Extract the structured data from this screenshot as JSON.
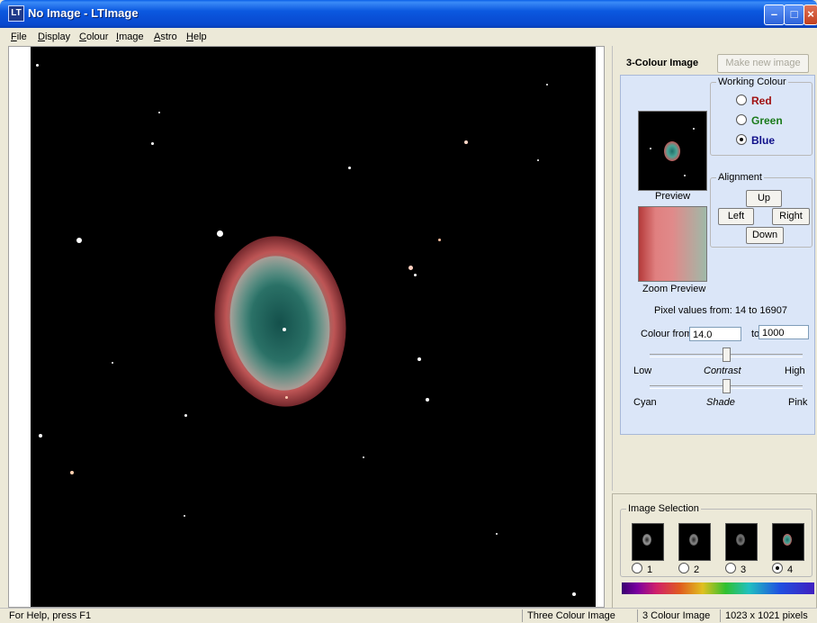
{
  "window": {
    "title": "No Image - LTImage",
    "app_icon": "LT"
  },
  "menu": [
    {
      "label": "File",
      "accel": "F"
    },
    {
      "label": "Display",
      "accel": "D"
    },
    {
      "label": "Colour",
      "accel": "C"
    },
    {
      "label": "Image",
      "accel": "I"
    },
    {
      "label": "Astro",
      "accel": "A"
    },
    {
      "label": "Help",
      "accel": "H"
    }
  ],
  "panel": {
    "title": "3-Colour Image",
    "make_new_image": "Make new image",
    "working_colour": {
      "legend": "Working Colour",
      "options": [
        {
          "label": "Red",
          "color": "#a01010",
          "selected": false
        },
        {
          "label": "Green",
          "color": "#1a7a1a",
          "selected": false
        },
        {
          "label": "Blue",
          "color": "#10108a",
          "selected": true
        }
      ]
    },
    "preview_label": "Preview",
    "zoom_preview_label": "Zoom Preview",
    "alignment": {
      "legend": "Alignment",
      "up": "Up",
      "left": "Left",
      "right": "Right",
      "down": "Down"
    },
    "pixel_values": "Pixel values from: 14 to 16907",
    "colour_from_label": "Colour from:",
    "colour_from_value": "14.0",
    "to_label": "to",
    "colour_to_value": "1000",
    "contrast": {
      "low": "Low",
      "center": "Contrast",
      "high": "High",
      "level": 0.5
    },
    "shade": {
      "low": "Cyan",
      "center": "Shade",
      "high": "Pink",
      "level": 0.5
    }
  },
  "image_selection": {
    "legend": "Image Selection",
    "items": [
      {
        "label": "1",
        "selected": false
      },
      {
        "label": "2",
        "selected": false
      },
      {
        "label": "3",
        "selected": false
      },
      {
        "label": "4",
        "selected": true
      }
    ]
  },
  "status": {
    "help": "For Help, press F1",
    "mode": "Three Colour Image",
    "type": "3 Colour Image",
    "size": "1023 x 1021 pixels"
  }
}
